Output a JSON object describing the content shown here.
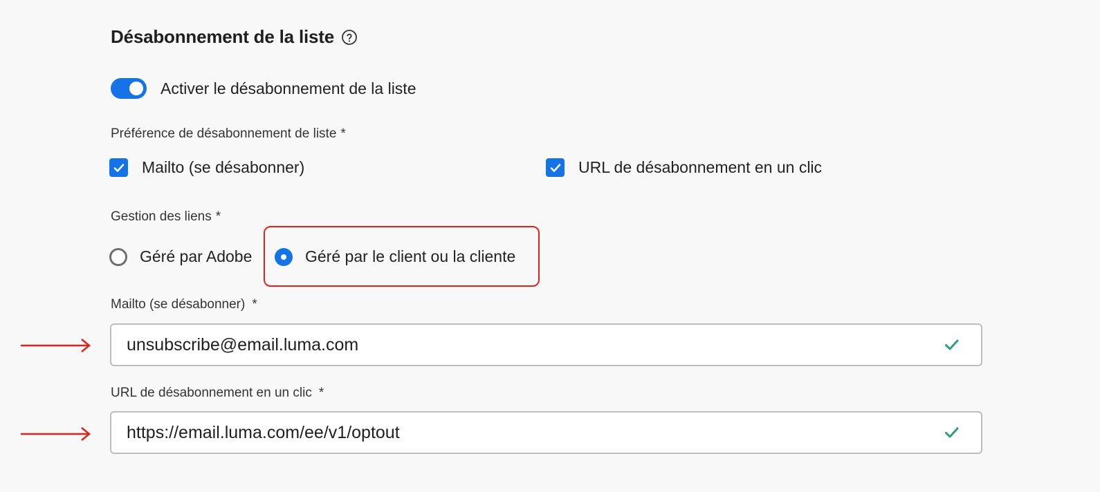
{
  "section": {
    "title": "Désabonnement de la liste",
    "help_icon": "help-circle-icon"
  },
  "toggle": {
    "label": "Activer le désabonnement de la liste",
    "on": true
  },
  "preference": {
    "label": "Préférence de désabonnement de liste",
    "required": "*",
    "options": [
      {
        "label": "Mailto (se désabonner)",
        "checked": true
      },
      {
        "label": "URL de désabonnement en un clic",
        "checked": true
      }
    ]
  },
  "link_management": {
    "label": "Gestion des liens",
    "required": "*",
    "options": [
      {
        "label": "Géré par Adobe",
        "selected": false
      },
      {
        "label": "Géré par le client ou la cliente",
        "selected": true
      }
    ]
  },
  "mailto_field": {
    "label": "Mailto (se désabonner)",
    "required": "*",
    "value": "unsubscribe@email.luma.com",
    "status_icon": "checkmark-icon"
  },
  "url_field": {
    "label": "URL de désabonnement en un clic",
    "required": "*",
    "value": "https://email.luma.com/ee/v1/optout",
    "status_icon": "checkmark-icon"
  },
  "colors": {
    "accent": "#1473e6",
    "highlight": "#e0231a",
    "valid": "#2d9d78"
  }
}
